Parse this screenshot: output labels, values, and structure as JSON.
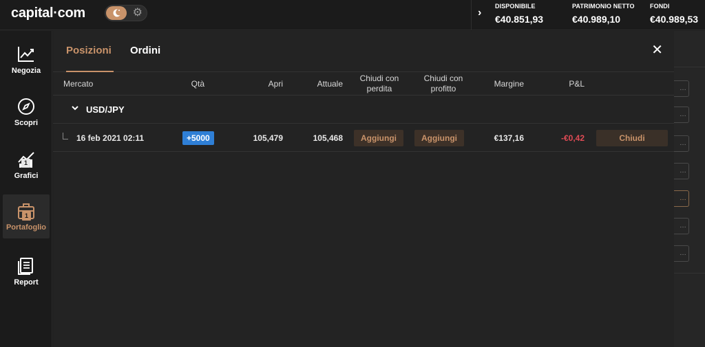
{
  "header": {
    "logo": "capital·com",
    "account": [
      {
        "label": "DISPONIBILE",
        "value": "€40.851,93"
      },
      {
        "label": "PATRIMONIO NETTO",
        "value": "€40.989,10"
      },
      {
        "label": "FONDI",
        "value": "€40.989,53"
      }
    ]
  },
  "sidebar": {
    "items": [
      {
        "label": "Negozia",
        "icon": "chart-line-icon"
      },
      {
        "label": "Scopri",
        "icon": "compass-icon"
      },
      {
        "label": "Grafici",
        "icon": "charts-icon",
        "badge": "1"
      },
      {
        "label": "Portafoglio",
        "icon": "briefcase-icon",
        "badge": "1"
      },
      {
        "label": "Report",
        "icon": "report-icon"
      }
    ]
  },
  "panel": {
    "tabs": [
      "Posizioni",
      "Ordini"
    ],
    "columns": {
      "market": "Mercato",
      "qty": "Qtà",
      "open": "Apri",
      "current": "Attuale",
      "stop_loss": "Chiudi con perdita",
      "take_profit": "Chiudi con profitto",
      "margin": "Margine",
      "pnl": "P&L"
    },
    "group": {
      "name": "USD/JPY"
    },
    "position": {
      "date": "16 feb 2021 02:11",
      "qty": "+5000",
      "open": "105,479",
      "current": "105,468",
      "stop_loss_btn": "Aggiungi",
      "take_profit_btn": "Aggiungi",
      "margin": "€137,16",
      "pnl": "-€0,42",
      "close_btn": "Chiudi"
    }
  },
  "colors": {
    "accent": "#c9936a",
    "negative": "#e04b55",
    "qty_badge": "#2f7fd6"
  }
}
